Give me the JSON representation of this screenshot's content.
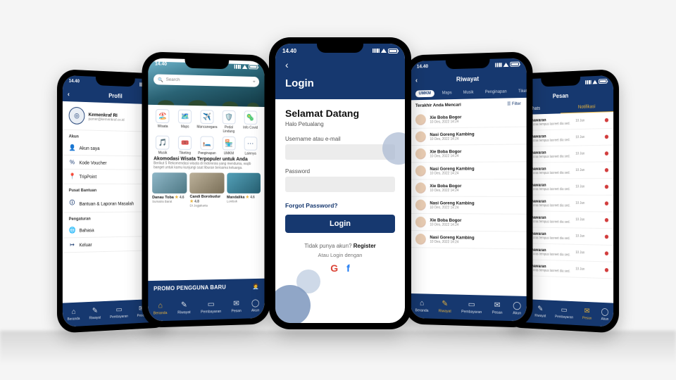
{
  "colors": {
    "navy": "#16386f",
    "gold": "#e7b23b"
  },
  "statusbar_time": "14.40",
  "bottom_nav": [
    "Beranda",
    "Riwayat",
    "Pembayaran",
    "Pesan",
    "Akun"
  ],
  "profil": {
    "title": "Profil",
    "user_name": "Kemenkraf RI",
    "user_email": "pamer@kemenkraf.co.id",
    "sections": {
      "akun": {
        "label": "Akun",
        "items": [
          "Akun saya",
          "Kode Voucher",
          "TripPoint"
        ]
      },
      "bantuan": {
        "label": "Pusat Bantuan",
        "items": [
          "Bantuan & Laporan Masalah"
        ]
      },
      "pengaturan": {
        "label": "Pengaturan",
        "items": [
          "Bahasa",
          "Keluar"
        ]
      }
    }
  },
  "home": {
    "search_placeholder": "Search",
    "categories": [
      "Wisata",
      "Maps",
      "Mancanegara",
      "Pedal Lindung",
      "Info Covid",
      "Musik",
      "Tiketing",
      "Penginapan",
      "UMKM",
      "Lainnya"
    ],
    "section_title": "Akomodasi Wisata Terpopuler untuk Anda",
    "section_sub": "Berikut 5 Rekomendasi wisata di Indonesia yang mendunia, wajib banget untuk kamu kunjungi saat liburan bersama keluarga.",
    "cards": [
      {
        "name": "Danau Toba",
        "loc": "Sumatra Barat",
        "rating": "4.6"
      },
      {
        "name": "Candi Borobudur",
        "loc": "DI Jogjakarta",
        "rating": "4.8"
      },
      {
        "name": "Mandalika",
        "loc": "Lombok",
        "rating": "4.6"
      }
    ],
    "promo": "PROMO PENGGUNA BARU"
  },
  "login": {
    "header": "Login",
    "welcome_title": "Selamat Datang",
    "welcome_sub": "Halo Petualang",
    "field_user": "Username atau e-mail",
    "field_pass": "Password",
    "forgot": "Forgot Password?",
    "login_btn": "Login",
    "noacc_pre": "Tidak punya akun? ",
    "noacc_link": "Register",
    "or": "Atau Login dengan"
  },
  "riwayat": {
    "title": "Riwayat",
    "tabs": [
      "UMKM",
      "Maps",
      "Musik",
      "Penginapan",
      "Tiketing"
    ],
    "subheader": "Terakhir Anda Mencari",
    "filter": "Filter",
    "items": [
      {
        "name": "Xie Boba Bogor",
        "date": "10 Des, 2022 14:24"
      },
      {
        "name": "Nasi Goreng Kambing",
        "date": "10 Des, 2022 14:24"
      },
      {
        "name": "Xie Boba Bogor",
        "date": "10 Des, 2022 14:24"
      },
      {
        "name": "Nasi Goreng Kambing",
        "date": "10 Des, 2022 14:24"
      },
      {
        "name": "Xie Boba Bogor",
        "date": "10 Des, 2022 14:24"
      },
      {
        "name": "Nasi Goreng Kambing",
        "date": "10 Des, 2022 14:24"
      },
      {
        "name": "Xie Boba Bogor",
        "date": "10 Des, 2022 14:24"
      },
      {
        "name": "Nasi Goreng Kambing",
        "date": "10 Des, 2022 14:24"
      }
    ]
  },
  "pesan": {
    "title": "Pesan",
    "tabs": [
      "Chats",
      "Notifikasi"
    ],
    "item_title": "Penawaran",
    "item_sub": "Sed cras tempus laoreet dia sed.",
    "item_date": "10 Jan",
    "items_count": 10
  }
}
